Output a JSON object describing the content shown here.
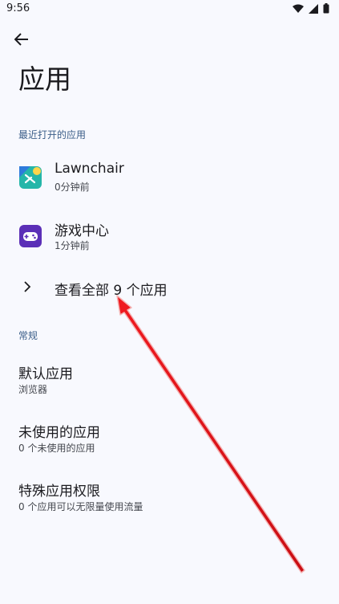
{
  "status": {
    "time": "9:56"
  },
  "page": {
    "title": "应用"
  },
  "recent": {
    "header": "最近打开的应用",
    "apps": [
      {
        "name": "Lawnchair",
        "sub": "0分钟前"
      },
      {
        "name": "游戏中心",
        "sub": "1分钟前"
      }
    ],
    "see_all": "查看全部 9 个应用"
  },
  "general": {
    "header": "常规",
    "items": [
      {
        "title": "默认应用",
        "sub": "浏览器"
      },
      {
        "title": "未使用的应用",
        "sub": "0 个未使用的应用"
      },
      {
        "title": "特殊应用权限",
        "sub": "0 个应用可以无限量使用流量"
      }
    ]
  },
  "colors": {
    "background": "#f8f9fe",
    "section_header": "#3a5d88",
    "annotation_arrow": "#e8121a"
  },
  "icons": [
    "back-arrow-icon",
    "chevron-right-icon",
    "wifi-icon",
    "signal-icon",
    "battery-icon"
  ]
}
